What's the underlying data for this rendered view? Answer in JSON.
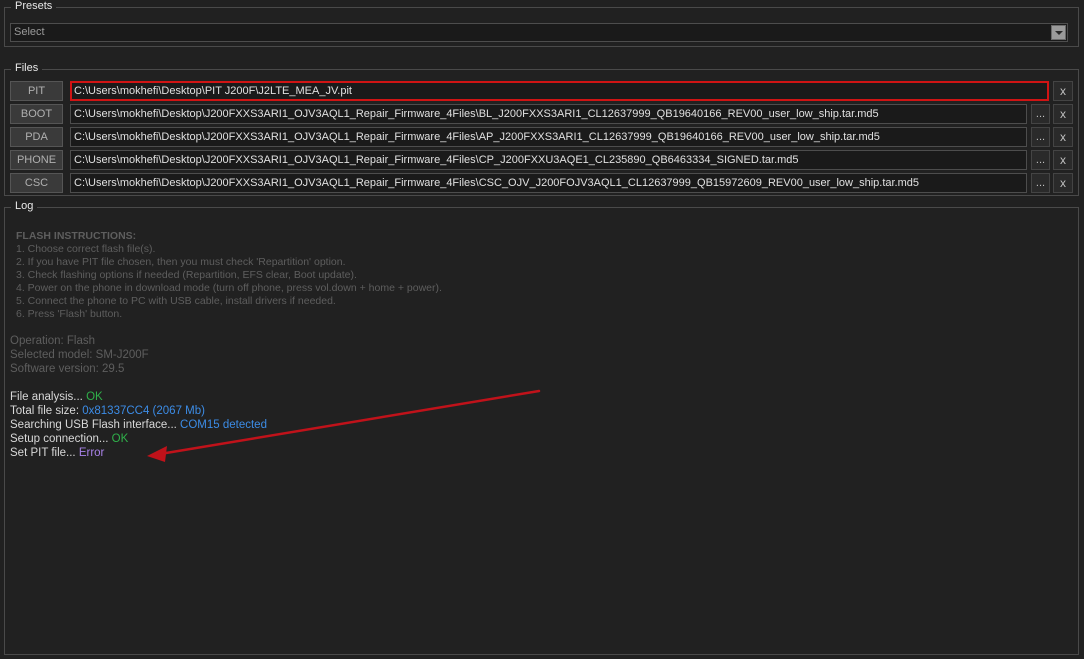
{
  "presets": {
    "title": "Presets",
    "selected": "Select"
  },
  "files": {
    "title": "Files",
    "rows": [
      {
        "label": "PIT",
        "path": "C:\\Users\\mokhefi\\Desktop\\PIT J200F\\J2LTE_MEA_JV.pit",
        "browse": "",
        "clear": "x"
      },
      {
        "label": "BOOT",
        "path": "C:\\Users\\mokhefi\\Desktop\\J200FXXS3ARI1_OJV3AQL1_Repair_Firmware_4Files\\BL_J200FXXS3ARI1_CL12637999_QB19640166_REV00_user_low_ship.tar.md5",
        "browse": "...",
        "clear": "x"
      },
      {
        "label": "PDA",
        "path": "C:\\Users\\mokhefi\\Desktop\\J200FXXS3ARI1_OJV3AQL1_Repair_Firmware_4Files\\AP_J200FXXS3ARI1_CL12637999_QB19640166_REV00_user_low_ship.tar.md5",
        "browse": "...",
        "clear": "x"
      },
      {
        "label": "PHONE",
        "path": "C:\\Users\\mokhefi\\Desktop\\J200FXXS3ARI1_OJV3AQL1_Repair_Firmware_4Files\\CP_J200FXXU3AQE1_CL235890_QB6463334_SIGNED.tar.md5",
        "browse": "...",
        "clear": "x"
      },
      {
        "label": "CSC",
        "path": "C:\\Users\\mokhefi\\Desktop\\J200FXXS3ARI1_OJV3AQL1_Repair_Firmware_4Files\\CSC_OJV_J200FOJV3AQL1_CL12637999_QB15972609_REV00_user_low_ship.tar.md5",
        "browse": "...",
        "clear": "x"
      }
    ]
  },
  "log": {
    "title": "Log",
    "instructions_title": "FLASH INSTRUCTIONS:",
    "instructions": [
      "1. Choose correct flash file(s).",
      "2. If you have PIT file chosen, then you must check 'Repartition' option.",
      "3. Check flashing options if needed (Repartition, EFS clear, Boot update).",
      "4. Power on the phone in download mode (turn off phone, press vol.down + home + power).",
      "5. Connect the phone to PC with USB cable, install drivers if needed.",
      "6. Press 'Flash' button."
    ],
    "info": [
      "Operation: Flash",
      "Selected model: SM-J200F",
      "Software version: 29.5"
    ],
    "status": [
      {
        "label": "File analysis... ",
        "value": "OK"
      },
      {
        "label": "Total file size: ",
        "value": "0x81337CC4 (2067 Mb)"
      },
      {
        "label": "Searching USB Flash interface... ",
        "value": "COM15 detected"
      },
      {
        "label": "Setup connection... ",
        "value": "OK"
      },
      {
        "label": "Set PIT file... ",
        "value": "Error"
      }
    ]
  },
  "colors": {
    "background": "#212121",
    "ok": "#2fb04a",
    "info": "#3c8ce6",
    "error": "#a882e8",
    "highlight": "#d01414"
  }
}
